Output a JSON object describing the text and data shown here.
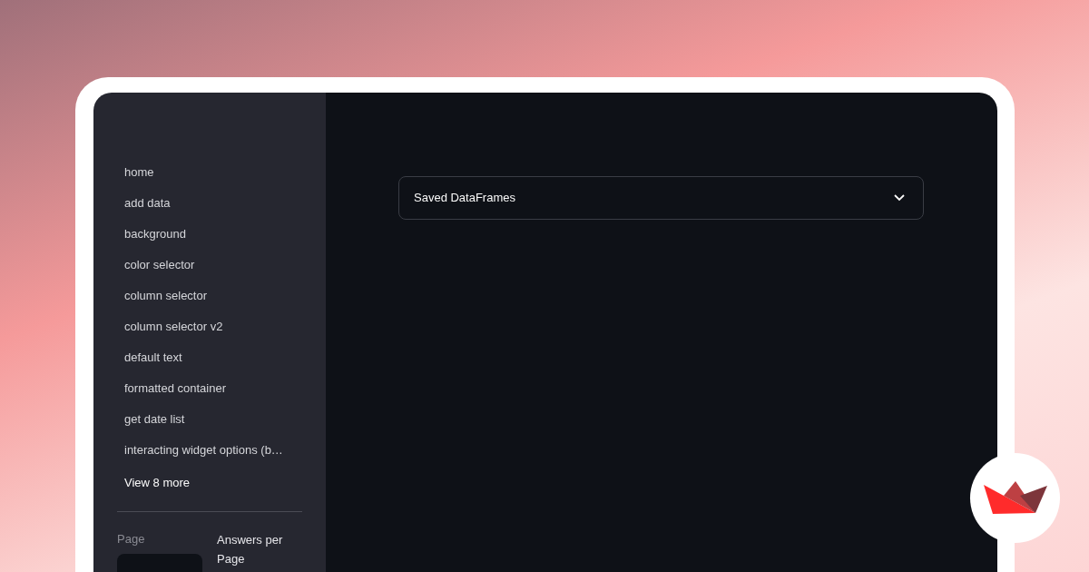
{
  "sidebar": {
    "items": [
      {
        "label": "home"
      },
      {
        "label": "add data"
      },
      {
        "label": "background"
      },
      {
        "label": "color selector"
      },
      {
        "label": "column selector"
      },
      {
        "label": "column selector v2"
      },
      {
        "label": "default text"
      },
      {
        "label": "formatted container"
      },
      {
        "label": "get date list"
      },
      {
        "label": "interacting widget options (b…"
      }
    ],
    "view_more": "View 8 more",
    "page_field": {
      "label": "Page"
    },
    "answers_label": "Answers per Page"
  },
  "main": {
    "select": {
      "value": "Saved DataFrames"
    }
  }
}
